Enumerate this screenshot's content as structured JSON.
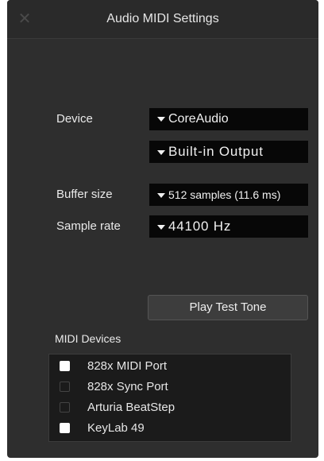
{
  "window": {
    "title": "Audio MIDI Settings",
    "close_glyph": "✕"
  },
  "audio": {
    "device_label": "Device",
    "device_driver": "CoreAudio",
    "device_output": "Built-in Output",
    "buffer_label": "Buffer size",
    "buffer_value": "512 samples (11.6 ms)",
    "rate_label": "Sample rate",
    "rate_value": "44100 Hz"
  },
  "test_tone": {
    "label": "Play Test Tone"
  },
  "midi": {
    "section_label": "MIDI Devices",
    "devices": [
      {
        "name": "828x MIDI Port",
        "checked": true
      },
      {
        "name": "828x Sync Port",
        "checked": false
      },
      {
        "name": "Arturia BeatStep",
        "checked": false
      },
      {
        "name": "KeyLab 49",
        "checked": true
      }
    ]
  },
  "icons": {
    "close": "close-icon",
    "dropdown": "chevron-down-icon",
    "checkbox": "checkbox-icon"
  },
  "colors": {
    "window_bg": "#2e2e2e",
    "select_bg": "#070707",
    "text": "#eaeaea"
  }
}
